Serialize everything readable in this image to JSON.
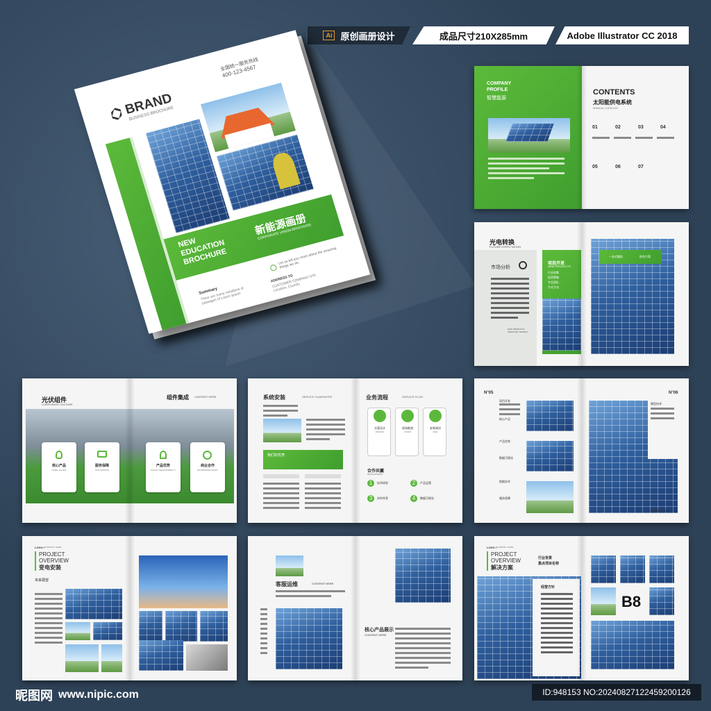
{
  "header": {
    "tag1": "原创画册设计",
    "tag1_icon": "Ai",
    "tag2": "成品尺寸210X285mm",
    "tag3": "Adobe Illustrator CC 2018"
  },
  "cover": {
    "brand": "BRAND",
    "brand_sub": "BUSINESS BROCHURE",
    "phone_label": "全国统一服务热线",
    "phone": "400-123-4567",
    "title_en_1": "NEW",
    "title_en_2": "EDUCATION",
    "title_en_3": "BROCHURE",
    "title_cn": "新能源画册",
    "title_cn_sub": "CORPORATE VISION BROCHURE",
    "intro": "Let us tell you more about the amazing things we do.",
    "summary_label": "Summary",
    "summary_text": "There are many variations of passages of Lorem Ipsum",
    "addr_label": "ADDRESS TO",
    "addr_text": "CUSTOMER COMPANY 976 Location, Country"
  },
  "p1": {
    "company_1": "COMPANY",
    "company_2": "PROFILE",
    "company_cn": "智慧能源",
    "contents": "CONTENTS",
    "contents_cn": "太阳能供电系统",
    "manual": "MANUAL CATALOG",
    "nums": [
      "01",
      "02",
      "03",
      "04",
      "05",
      "06",
      "07"
    ]
  },
  "p2": {
    "title": "光电转换",
    "sub": "FUTURE EXPECTATION",
    "market": "市场分析",
    "project": "项目开发",
    "new_products": "NEW PRODUCTS",
    "list": [
      "行业前景",
      "投资策略",
      "专业团队",
      "方式方法"
    ],
    "creative": "NEW PRODUCTS CREATIVE / DESIGN",
    "btn1": "一站式服务",
    "btn2": "综合方案"
  },
  "p3": {
    "title": "光伏组件",
    "sub": "CORPORATE CULTURE",
    "title2": "组件集成",
    "sub2": "CONTENT HERE",
    "cards": [
      {
        "cn": "核心产品",
        "en": "CORE VALUES"
      },
      {
        "cn": "服务保障",
        "en": "OUR MISSION"
      },
      {
        "cn": "产品优势",
        "en": "SOCIAL RESPONSIBILITY"
      },
      {
        "cn": "商业合作",
        "en": "ENTERPRISE SPIRIT"
      }
    ]
  },
  "p4": {
    "title": "系统安装",
    "sub": "SERVICE GUARANTEE",
    "title2": "业务流程",
    "sub2": "SERVICE FLOW",
    "band": "我们的优势",
    "steps": [
      {
        "cn": "方案设计",
        "en": "MISSION"
      },
      {
        "cn": "现场勘测",
        "en": "VISION"
      },
      {
        "cn": "安装调试",
        "en": "IDEA"
      }
    ],
    "coop": "合作共赢",
    "coop_sub": "DEVELOPMENT",
    "items": [
      "技术研发",
      "产品运营",
      "实时共享",
      "数据可视化"
    ]
  },
  "p5": {
    "n1": "N°05",
    "n2": "N°06",
    "left_list": [
      "项目开发",
      "核心产品",
      "产品优势",
      "数据可视化",
      "智能技术",
      "服务保障"
    ],
    "right_list": [
      "模型技术",
      "数据展示分析"
    ]
  },
  "p6": {
    "logo": "LOGO /",
    "company": "COMPANY NAME",
    "title_1": "PROJECT",
    "title_2": "OVERVIEW",
    "title_cn": "变电安装",
    "sub": "未来展望"
  },
  "p7": {
    "title": "客服运维",
    "content": "CONTENT HERE",
    "title2": "核心产品展示",
    "sub2": "CONTENT HERE"
  },
  "p8": {
    "logo": "LOGO /",
    "company": "COMPANY NAME",
    "title_1": "PROJECT",
    "title_2": "OVERVIEW",
    "title_cn": "解决方案",
    "industry": "行业背景",
    "key": "重点项目名称",
    "plan": "经营方针",
    "big": "B8"
  },
  "footer": {
    "logo": "昵图网",
    "url": "www.nipic.com",
    "id": "ID:948153 NO:20240827122459200126"
  }
}
